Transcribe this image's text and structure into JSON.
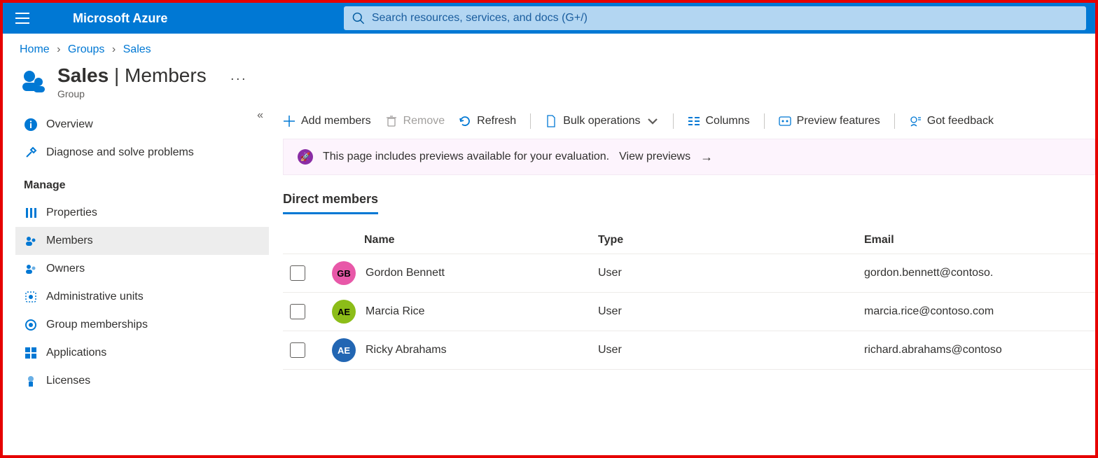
{
  "topbar": {
    "brand": "Microsoft Azure",
    "search_placeholder": "Search resources, services, and docs (G+/)"
  },
  "breadcrumb": {
    "items": [
      "Home",
      "Groups",
      "Sales"
    ]
  },
  "header": {
    "title_strong": "Sales",
    "title_rest": " | Members",
    "subtitle": "Group"
  },
  "sidebar": {
    "overview": "Overview",
    "diagnose": "Diagnose and solve problems",
    "manage_section": "Manage",
    "properties": "Properties",
    "members": "Members",
    "owners": "Owners",
    "admin_units": "Administrative units",
    "group_memberships": "Group memberships",
    "applications": "Applications",
    "licenses": "Licenses"
  },
  "toolbar": {
    "add_members": "Add members",
    "remove": "Remove",
    "refresh": "Refresh",
    "bulk_ops": "Bulk operations",
    "columns": "Columns",
    "preview_features": "Preview features",
    "feedback": "Got feedback"
  },
  "banner": {
    "text": "This page includes previews available for your evaluation. ",
    "link": "View previews"
  },
  "tabs": {
    "direct_members": "Direct members"
  },
  "table": {
    "headers": {
      "name": "Name",
      "type": "Type",
      "email": "Email"
    },
    "rows": [
      {
        "initials": "GB",
        "color": "#e858a8",
        "name": "Gordon Bennett",
        "type": "User",
        "email": "gordon.bennett@contoso."
      },
      {
        "initials": "AE",
        "color": "#8cbd18",
        "name": "Marcia Rice",
        "type": "User",
        "email": "marcia.rice@contoso.com"
      },
      {
        "initials": "AE",
        "color": "#2266b3",
        "name": "Ricky Abrahams",
        "type": "User",
        "email": "richard.abrahams@contoso"
      }
    ]
  }
}
